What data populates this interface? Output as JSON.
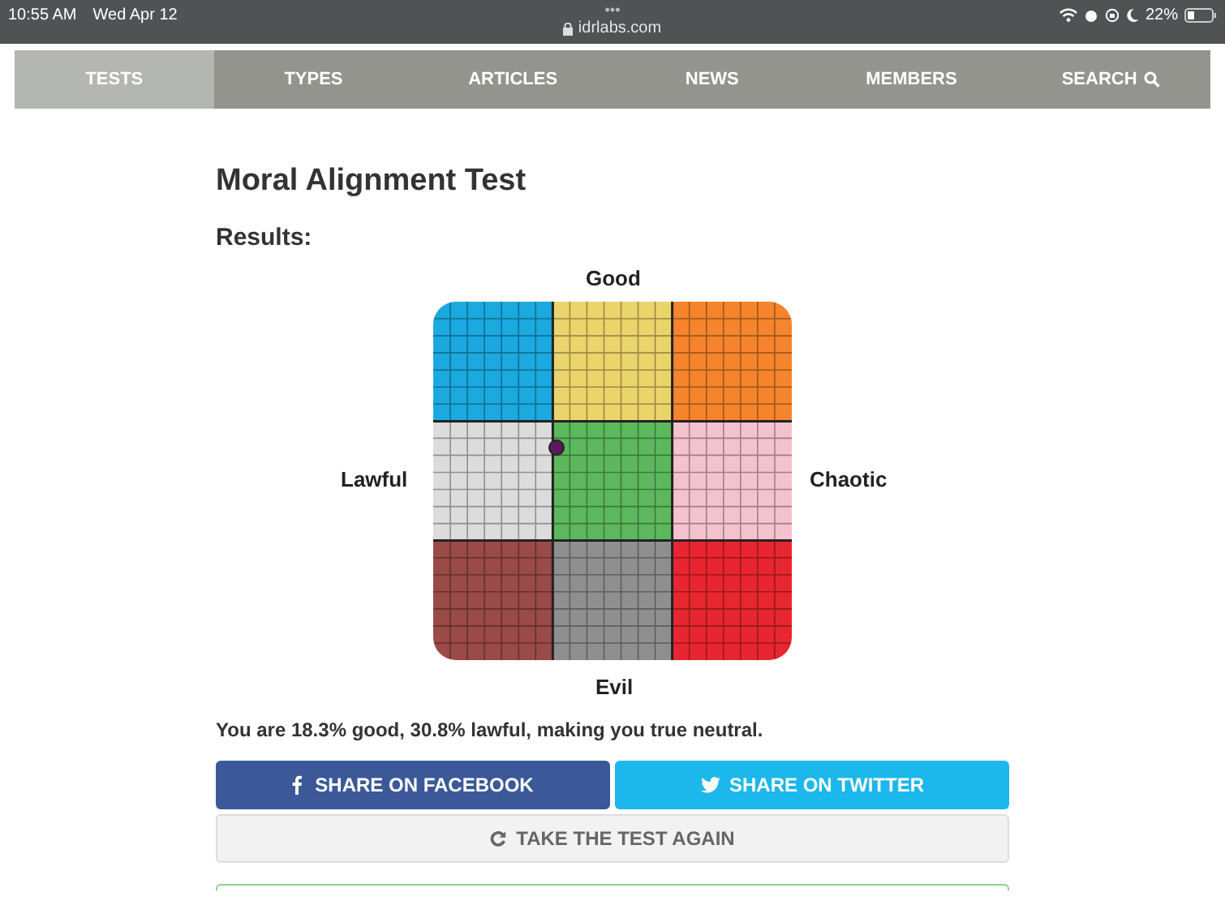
{
  "status_bar": {
    "time": "10:55 AM",
    "date": "Wed Apr 12",
    "dots": "•••",
    "url": "idrlabs.com",
    "battery": "22%"
  },
  "nav": [
    {
      "label": "TESTS",
      "selected": true
    },
    {
      "label": "TYPES",
      "selected": false
    },
    {
      "label": "ARTICLES",
      "selected": false
    },
    {
      "label": "NEWS",
      "selected": false
    },
    {
      "label": "MEMBERS",
      "selected": false
    },
    {
      "label": "SEARCH",
      "selected": false,
      "kind": "search"
    }
  ],
  "title": "Moral Alignment Test",
  "results_label": "Results:",
  "chart": {
    "top": "Good",
    "left": "Lawful",
    "right": "Chaotic",
    "bottom": "Evil",
    "cells": [
      {
        "color": "#1ba9e0"
      },
      {
        "color": "#ebd46b"
      },
      {
        "color": "#f5842c"
      },
      {
        "color": "#dcdcdc"
      },
      {
        "color": "#5cb85c"
      },
      {
        "color": "#f4c2cf"
      },
      {
        "color": "#9a4a47"
      },
      {
        "color": "#8f8f8f"
      },
      {
        "color": "#e8262f"
      }
    ]
  },
  "summary": "You are 18.3% good, 30.8% lawful, making you true neutral.",
  "buttons": [
    {
      "label": "SHARE ON FACEBOOK",
      "kind": "facebook"
    },
    {
      "label": "SHARE ON TWITTER",
      "kind": "twitter"
    },
    {
      "label": "TAKE THE TEST AGAIN",
      "kind": "retake"
    }
  ]
}
